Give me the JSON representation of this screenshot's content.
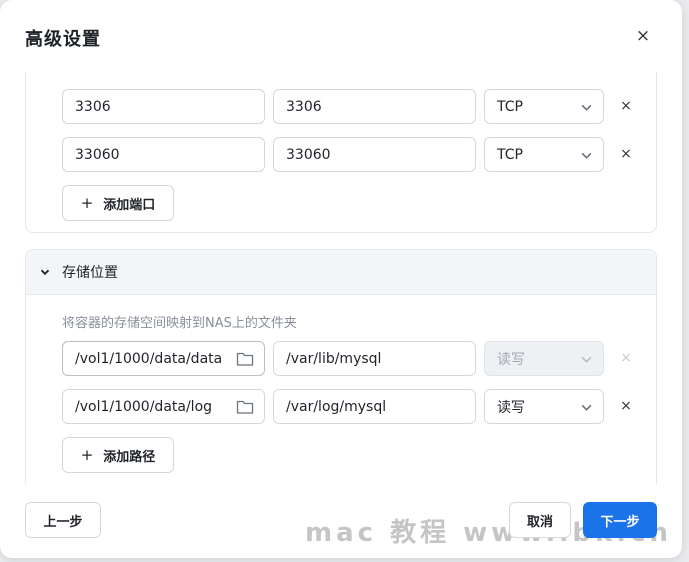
{
  "dialog": {
    "title": "高级设置",
    "close_glyph": "×"
  },
  "ports": {
    "rows": [
      {
        "host_port": "3306",
        "container_port": "3306",
        "protocol": "TCP"
      },
      {
        "host_port": "33060",
        "container_port": "33060",
        "protocol": "TCP"
      }
    ],
    "add_label": "添加端口"
  },
  "storage": {
    "title": "存储位置",
    "description": "将容器的存储空间映射到NAS上的文件夹",
    "rows": [
      {
        "host_path": "/vol1/1000/data/data",
        "container_path": "/var/lib/mysql",
        "mode": "读写",
        "disabled": true
      },
      {
        "host_path": "/vol1/1000/data/log",
        "container_path": "/var/log/mysql",
        "mode": "读写",
        "disabled": false
      }
    ],
    "add_label": "添加路径"
  },
  "footer": {
    "prev_label": "上一步",
    "cancel_label": "取消",
    "next_label": "下一步"
  },
  "watermark": "mac 教程 www.lbk.cn",
  "colors": {
    "primary": "#1a73e8",
    "panel_header_bg": "#f3f5f8",
    "border": "#d4d8de",
    "disabled_bg": "#eef1f4"
  }
}
